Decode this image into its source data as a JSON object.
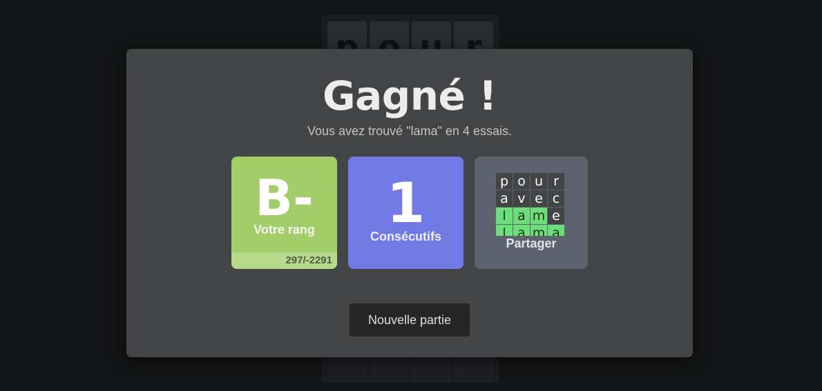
{
  "board": {
    "top_row": [
      "p",
      "o",
      "u",
      "r"
    ],
    "bottom_row": [
      "",
      "",
      "",
      ""
    ]
  },
  "modal": {
    "title": "Gagné !",
    "subtitle": "Vous avez trouvé \"lama\" en 4 essais.",
    "rank": {
      "value": "B-",
      "label": "Votre rang",
      "score": "297/-2291",
      "color": "#a2cd68"
    },
    "streak": {
      "value": "1",
      "label": "Consécutifs",
      "color": "#717ae4"
    },
    "share": {
      "label": "Partager",
      "grid": [
        [
          {
            "c": "p",
            "ok": false
          },
          {
            "c": "o",
            "ok": false
          },
          {
            "c": "u",
            "ok": false
          },
          {
            "c": "r",
            "ok": false
          }
        ],
        [
          {
            "c": "a",
            "ok": false
          },
          {
            "c": "v",
            "ok": false
          },
          {
            "c": "e",
            "ok": false
          },
          {
            "c": "c",
            "ok": false
          }
        ],
        [
          {
            "c": "l",
            "ok": true
          },
          {
            "c": "a",
            "ok": true
          },
          {
            "c": "m",
            "ok": true
          },
          {
            "c": "e",
            "ok": false
          }
        ],
        [
          {
            "c": "l",
            "ok": true
          },
          {
            "c": "a",
            "ok": true
          },
          {
            "c": "m",
            "ok": true
          },
          {
            "c": "a",
            "ok": true
          }
        ]
      ]
    },
    "new_game_label": "Nouvelle partie"
  }
}
